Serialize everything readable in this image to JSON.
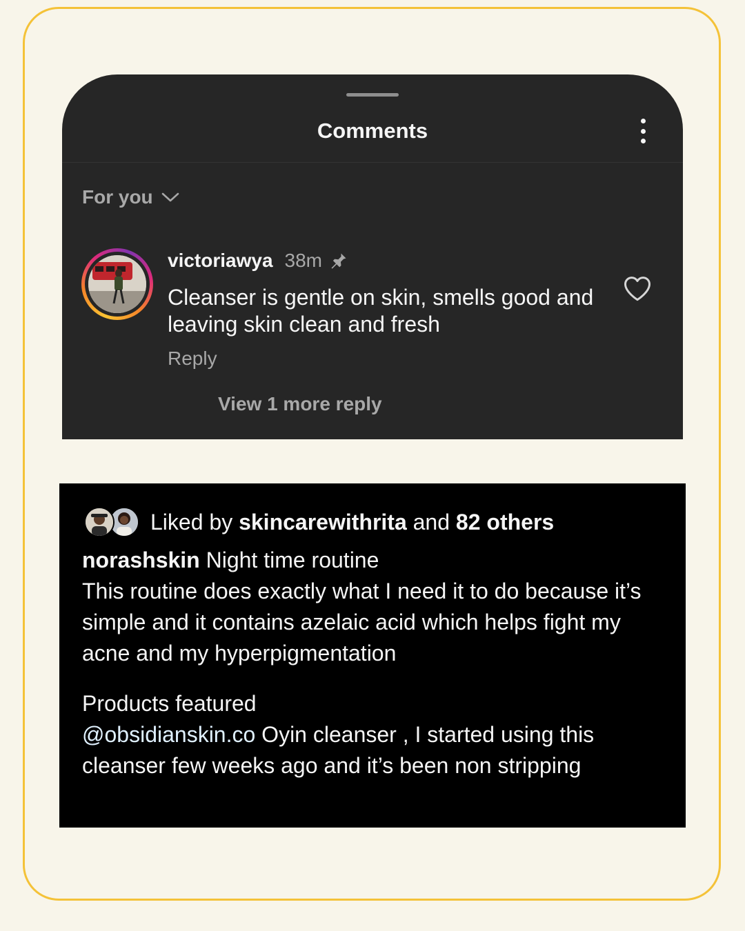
{
  "sheet": {
    "title": "Comments",
    "filter_label": "For you"
  },
  "comment": {
    "username": "victoriawya",
    "time": "38m",
    "text": "Cleanser is gentle on skin, smells good and leaving skin clean and fresh",
    "reply_label": "Reply",
    "view_more_label": "View 1 more reply"
  },
  "post": {
    "liked_prefix": "Liked by",
    "liked_user": "skincarewithrita",
    "liked_and": "and",
    "liked_others": "82 others",
    "author": "norashskin",
    "caption_title": "Night time routine",
    "caption_body": "This routine does exactly what I need it to do because it’s simple and it contains azelaic acid which helps fight my acne and my hyperpigmentation",
    "products_heading": "Products featured",
    "mention": "@obsidianskin.co",
    "product_text": "Oyin cleanser , I started using this cleanser few weeks ago and it’s been non stripping"
  },
  "colors": {
    "background": "#f8f5ea",
    "frame_border": "#f4c238",
    "sheet_bg": "#262626",
    "post_bg": "#000000",
    "secondary_text": "#a8a8a8"
  },
  "icons": [
    "more-vertical-icon",
    "chevron-down-icon",
    "pin-icon",
    "heart-outline-icon"
  ]
}
